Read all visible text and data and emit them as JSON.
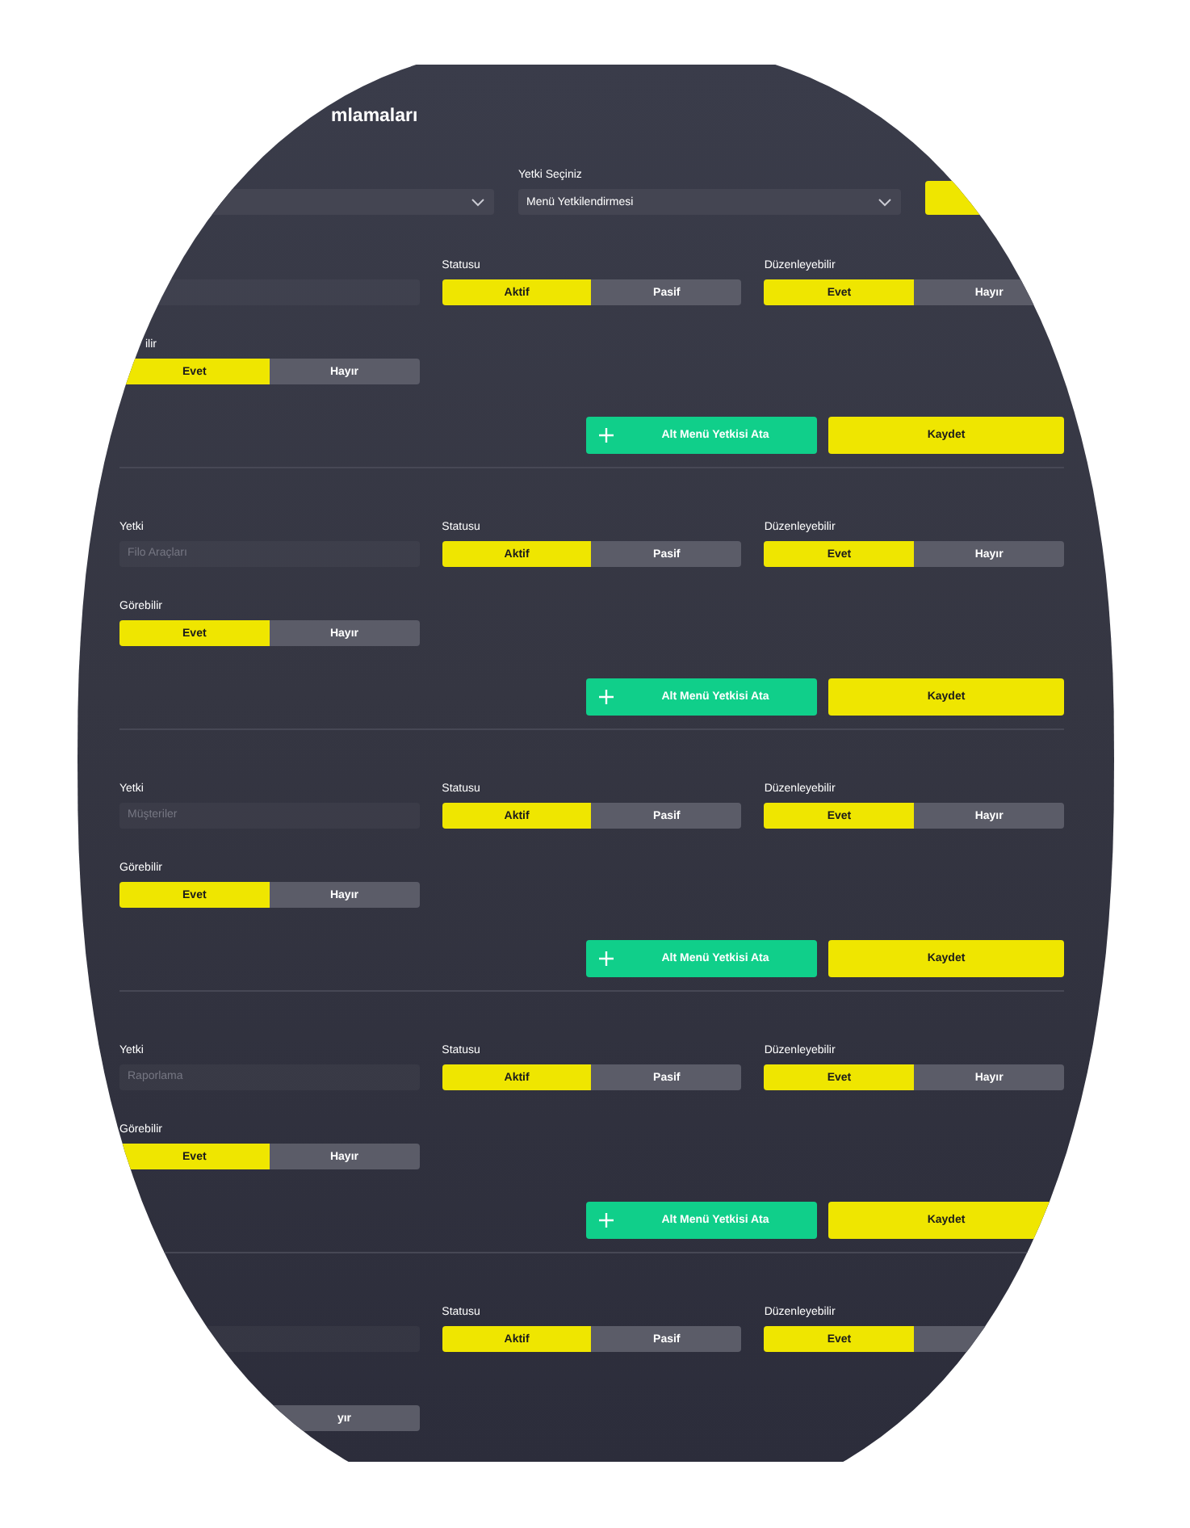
{
  "header": {
    "title": "mlamaları"
  },
  "selects": [
    {
      "kind": "dropdown"
    },
    {
      "kind": "dropdown",
      "label": "Yetki Seçiniz",
      "value": "Menü Yetkilendirmesi"
    }
  ],
  "permissions": [
    {
      "fields": [
        {
          "kind": "text"
        },
        {
          "kind": "toggle",
          "label": "Statusu",
          "yes_option": {
            "label": "Aktif",
            "selected": true
          },
          "no_option": {
            "label": "Pasif",
            "selected": false
          }
        },
        {
          "kind": "toggle",
          "label": "Düzenleyebilir",
          "yes_option": {
            "label": "Evet",
            "selected": true
          },
          "no_option": {
            "label": "Hayır",
            "selected": false
          }
        },
        {
          "kind": "toggle",
          "label": "ilir",
          "yes_option": {
            "label": "Evet",
            "selected": true
          },
          "no_option": {
            "label": "Hayır",
            "selected": false
          }
        }
      ],
      "buttons": [
        {
          "kind": "add",
          "label": "Alt Menü Yetkisi Ata"
        },
        {
          "kind": "save",
          "label": "Kaydet"
        }
      ]
    },
    {
      "fields": [
        {
          "kind": "text",
          "label": "Yetki",
          "value": "Filo Araçları",
          "disabled": true
        },
        {
          "kind": "toggle",
          "label": "Statusu",
          "yes_option": {
            "label": "Aktif",
            "selected": true
          },
          "no_option": {
            "label": "Pasif",
            "selected": false
          }
        },
        {
          "kind": "toggle",
          "label": "Düzenleyebilir",
          "yes_option": {
            "label": "Evet",
            "selected": true
          },
          "no_option": {
            "label": "Hayır",
            "selected": false
          }
        },
        {
          "kind": "toggle",
          "label": "Görebilir",
          "yes_option": {
            "label": "Evet",
            "selected": true
          },
          "no_option": {
            "label": "Hayır",
            "selected": false
          }
        }
      ],
      "buttons": [
        {
          "kind": "add",
          "label": "Alt Menü Yetkisi Ata"
        },
        {
          "kind": "save",
          "label": "Kaydet"
        }
      ]
    },
    {
      "fields": [
        {
          "kind": "text",
          "label": "Yetki",
          "value": "Müşteriler",
          "disabled": true
        },
        {
          "kind": "toggle",
          "label": "Statusu",
          "yes_option": {
            "label": "Aktif",
            "selected": true
          },
          "no_option": {
            "label": "Pasif",
            "selected": false
          }
        },
        {
          "kind": "toggle",
          "label": "Düzenleyebilir",
          "yes_option": {
            "label": "Evet",
            "selected": true
          },
          "no_option": {
            "label": "Hayır",
            "selected": false
          }
        },
        {
          "kind": "toggle",
          "label": "Görebilir",
          "yes_option": {
            "label": "Evet",
            "selected": true
          },
          "no_option": {
            "label": "Hayır",
            "selected": false
          }
        }
      ],
      "buttons": [
        {
          "kind": "add",
          "label": "Alt Menü Yetkisi Ata"
        },
        {
          "kind": "save",
          "label": "Kaydet"
        }
      ]
    },
    {
      "fields": [
        {
          "kind": "text",
          "label": "Yetki",
          "value": "Raporlama",
          "disabled": true
        },
        {
          "kind": "toggle",
          "label": "Statusu",
          "yes_option": {
            "label": "Aktif",
            "selected": true
          },
          "no_option": {
            "label": "Pasif",
            "selected": false
          }
        },
        {
          "kind": "toggle",
          "label": "Düzenleyebilir",
          "yes_option": {
            "label": "Evet",
            "selected": true
          },
          "no_option": {
            "label": "Hayır",
            "selected": false
          }
        },
        {
          "kind": "toggle",
          "label": "Görebilir",
          "yes_option": {
            "label": "Evet",
            "selected": true
          },
          "no_option": {
            "label": "Hayır",
            "selected": false
          }
        }
      ],
      "buttons": [
        {
          "kind": "add",
          "label": "Alt Menü Yetkisi Ata"
        },
        {
          "kind": "save",
          "label": "Kaydet"
        }
      ]
    },
    {
      "fields": [
        {
          "kind": "text"
        },
        {
          "kind": "toggle",
          "label": "Statusu",
          "yes_option": {
            "label": "Aktif",
            "selected": true
          },
          "no_option": {
            "label": "Pasif",
            "selected": false
          }
        },
        {
          "kind": "toggle",
          "label": "Düzenleyebilir",
          "yes_option": {
            "label": "Evet",
            "selected": true
          },
          "no_option": {
            "selected": false
          }
        },
        {
          "kind": "toggle",
          "no_option": {
            "label": "yır",
            "selected": false
          }
        }
      ]
    }
  ]
}
